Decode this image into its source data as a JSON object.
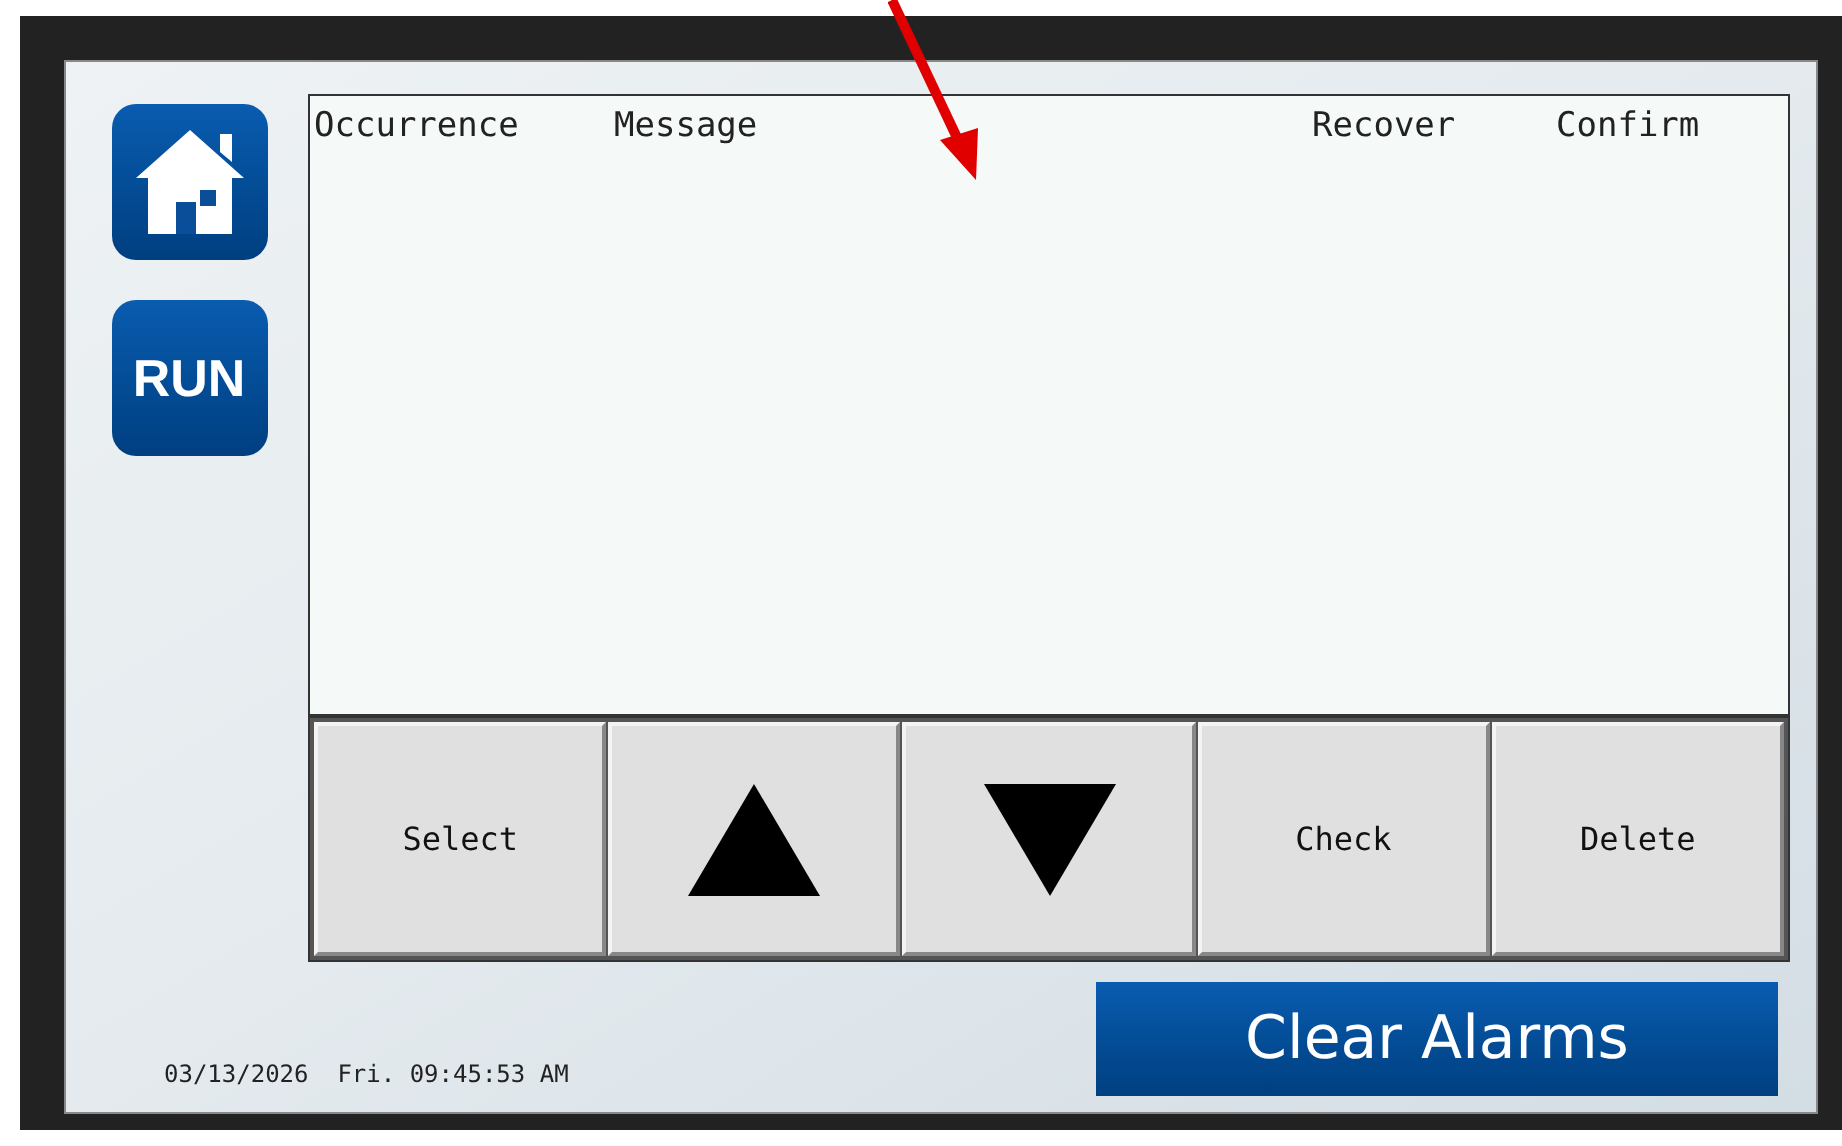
{
  "side_buttons": [
    {
      "kind": "home"
    },
    {
      "kind": "text",
      "label": "RUN"
    }
  ],
  "table": {
    "columns": [
      "Occurrence",
      "Message",
      "Recover",
      "Confirm"
    ]
  },
  "buttons": [
    {
      "kind": "text",
      "label": "Select"
    },
    {
      "kind": "up"
    },
    {
      "kind": "down"
    },
    {
      "kind": "text",
      "label": "Check"
    },
    {
      "kind": "text",
      "label": "Delete"
    }
  ],
  "clear_button": "Clear Alarms",
  "datetime": "03/13/2026  Fri. 09:45:53 AM"
}
